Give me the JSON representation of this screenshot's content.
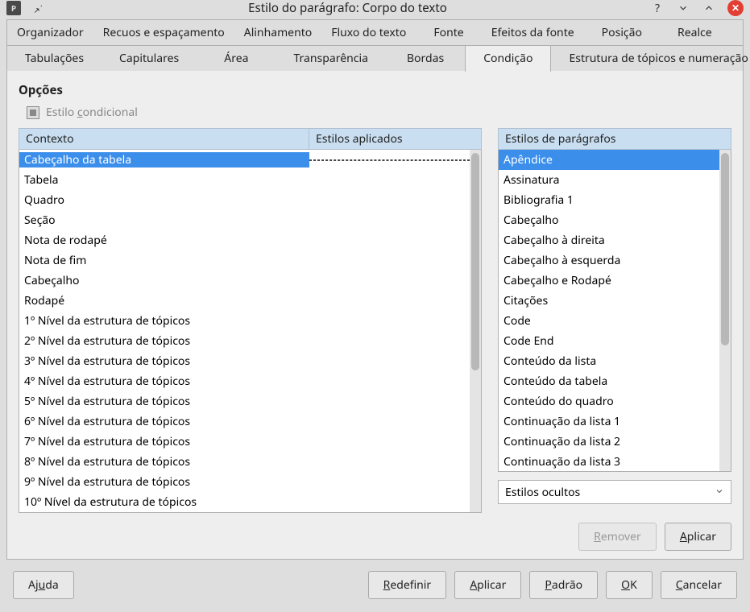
{
  "titlebar": {
    "title": "Estilo do parágrafo: Corpo do texto"
  },
  "tabs_row1": {
    "organizador": "Organizador",
    "recuos": "Recuos e espaçamento",
    "alinhamento": "Alinhamento",
    "fluxo": "Fluxo do texto",
    "fonte": "Fonte",
    "efeitos": "Efeitos da fonte",
    "posicao": "Posição",
    "realce": "Realce"
  },
  "tabs_row2": {
    "tabulacoes": "Tabulações",
    "capitulares": "Capitulares",
    "area": "Área",
    "transparencia": "Transparência",
    "bordas": "Bordas",
    "condicao": "Condição",
    "estrutura": "Estrutura de tópicos e numeração"
  },
  "options": {
    "title": "Opções",
    "conditional_style": "Estilo condicional"
  },
  "headers": {
    "contexto": "Contexto",
    "estilos_aplicados": "Estilos aplicados",
    "estilos_paragrafos": "Estilos de parágrafos"
  },
  "context_items": [
    "Cabeçalho da tabela",
    "Tabela",
    "Quadro",
    "Seção",
    "Nota de rodapé",
    "Nota de fim",
    "Cabeçalho",
    "Rodapé",
    " 1º Nível da estrutura de tópicos",
    " 2º Nível da estrutura de tópicos",
    " 3º Nível da estrutura de tópicos",
    " 4º Nível da estrutura de tópicos",
    " 5º Nível da estrutura de tópicos",
    " 6º Nível da estrutura de tópicos",
    " 7º Nível da estrutura de tópicos",
    " 8º Nível da estrutura de tópicos",
    " 9º Nível da estrutura de tópicos",
    " 10º Nível da estrutura de tópicos"
  ],
  "paragraph_styles": [
    "Apêndice",
    "Assinatura",
    "Bibliografia 1",
    "Cabeçalho",
    "Cabeçalho à direita",
    "Cabeçalho à esquerda",
    "Cabeçalho e Rodapé",
    "Citações",
    "Code",
    "Code End",
    "Conteúdo da lista",
    "Conteúdo da tabela",
    "Conteúdo do quadro",
    "Continuação da lista 1",
    "Continuação da lista 2",
    "Continuação da lista 3"
  ],
  "dropdown": {
    "value": "Estilos ocultos"
  },
  "mid_buttons": {
    "remover": "Remover",
    "aplicar": "Aplicar"
  },
  "footer": {
    "ajuda": "Ajuda",
    "redefinir": "Redefinir",
    "aplicar": "Aplicar",
    "padrao": "Padrão",
    "ok": "OK",
    "cancelar": "Cancelar"
  }
}
